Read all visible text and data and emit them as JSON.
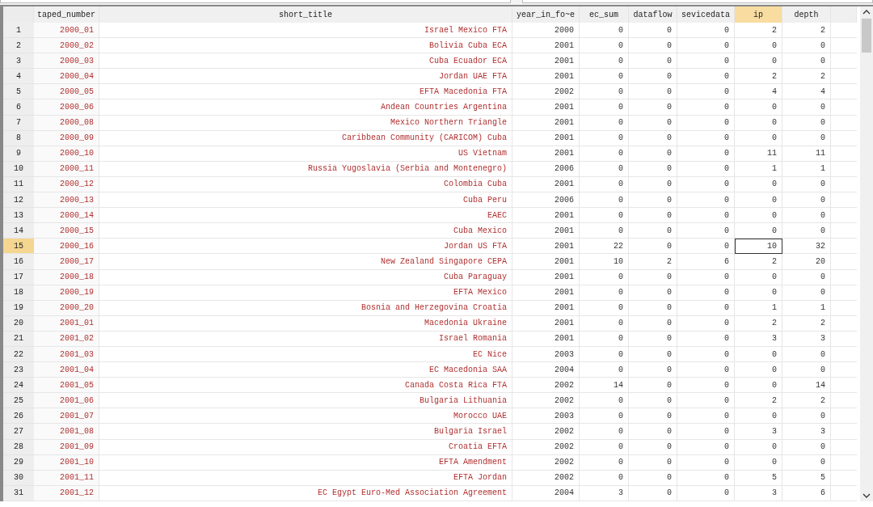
{
  "columns": [
    {
      "label": "taped_number",
      "kind": "string",
      "selected": false
    },
    {
      "label": "short_title",
      "kind": "string",
      "selected": false
    },
    {
      "label": "year_in_fo~e",
      "kind": "number",
      "selected": false
    },
    {
      "label": "ec_sum",
      "kind": "number",
      "selected": false
    },
    {
      "label": "dataflow",
      "kind": "number",
      "selected": false
    },
    {
      "label": "sevicedata",
      "kind": "number",
      "selected": false
    },
    {
      "label": "ip",
      "kind": "number",
      "selected": true
    },
    {
      "label": "depth",
      "kind": "number",
      "selected": false
    }
  ],
  "rows": [
    {
      "number": "1",
      "selected": false,
      "cells": [
        "2000_01",
        "Israel Mexico FTA",
        "2000",
        "0",
        "0",
        "0",
        "2",
        "2"
      ]
    },
    {
      "number": "2",
      "selected": false,
      "cells": [
        "2000_02",
        "Bolivia Cuba ECA",
        "2001",
        "0",
        "0",
        "0",
        "0",
        "0"
      ]
    },
    {
      "number": "3",
      "selected": false,
      "cells": [
        "2000_03",
        "Cuba Ecuador ECA",
        "2001",
        "0",
        "0",
        "0",
        "0",
        "0"
      ]
    },
    {
      "number": "4",
      "selected": false,
      "cells": [
        "2000_04",
        "Jordan UAE FTA",
        "2001",
        "0",
        "0",
        "0",
        "2",
        "2"
      ]
    },
    {
      "number": "5",
      "selected": false,
      "cells": [
        "2000_05",
        "EFTA Macedonia FTA",
        "2002",
        "0",
        "0",
        "0",
        "4",
        "4"
      ]
    },
    {
      "number": "6",
      "selected": false,
      "cells": [
        "2000_06",
        "Andean Countries Argentina",
        "2001",
        "0",
        "0",
        "0",
        "0",
        "0"
      ]
    },
    {
      "number": "7",
      "selected": false,
      "cells": [
        "2000_08",
        "Mexico Northern Triangle",
        "2001",
        "0",
        "0",
        "0",
        "0",
        "0"
      ]
    },
    {
      "number": "8",
      "selected": false,
      "cells": [
        "2000_09",
        "Caribbean Community (CARICOM) Cuba",
        "2001",
        "0",
        "0",
        "0",
        "0",
        "0"
      ]
    },
    {
      "number": "9",
      "selected": false,
      "cells": [
        "2000_10",
        "US Vietnam",
        "2001",
        "0",
        "0",
        "0",
        "11",
        "11"
      ]
    },
    {
      "number": "10",
      "selected": false,
      "cells": [
        "2000_11",
        "Russia Yugoslavia (Serbia and Montenegro)",
        "2006",
        "0",
        "0",
        "0",
        "1",
        "1"
      ]
    },
    {
      "number": "11",
      "selected": false,
      "cells": [
        "2000_12",
        "Colombia Cuba",
        "2001",
        "0",
        "0",
        "0",
        "0",
        "0"
      ]
    },
    {
      "number": "12",
      "selected": false,
      "cells": [
        "2000_13",
        "Cuba Peru",
        "2006",
        "0",
        "0",
        "0",
        "0",
        "0"
      ]
    },
    {
      "number": "13",
      "selected": false,
      "cells": [
        "2000_14",
        "EAEC",
        "2001",
        "0",
        "0",
        "0",
        "0",
        "0"
      ]
    },
    {
      "number": "14",
      "selected": false,
      "cells": [
        "2000_15",
        "Cuba Mexico",
        "2001",
        "0",
        "0",
        "0",
        "0",
        "0"
      ]
    },
    {
      "number": "15",
      "selected": true,
      "cells": [
        "2000_16",
        "Jordan US FTA",
        "2001",
        "22",
        "0",
        "0",
        "10",
        "32"
      ]
    },
    {
      "number": "16",
      "selected": false,
      "cells": [
        "2000_17",
        "New Zealand Singapore CEPA",
        "2001",
        "10",
        "2",
        "6",
        "2",
        "20"
      ]
    },
    {
      "number": "17",
      "selected": false,
      "cells": [
        "2000_18",
        "Cuba Paraguay",
        "2001",
        "0",
        "0",
        "0",
        "0",
        "0"
      ]
    },
    {
      "number": "18",
      "selected": false,
      "cells": [
        "2000_19",
        "EFTA Mexico",
        "2001",
        "0",
        "0",
        "0",
        "0",
        "0"
      ]
    },
    {
      "number": "19",
      "selected": false,
      "cells": [
        "2000_20",
        "Bosnia and Herzegovina Croatia",
        "2001",
        "0",
        "0",
        "0",
        "1",
        "1"
      ]
    },
    {
      "number": "20",
      "selected": false,
      "cells": [
        "2001_01",
        "Macedonia Ukraine",
        "2001",
        "0",
        "0",
        "0",
        "2",
        "2"
      ]
    },
    {
      "number": "21",
      "selected": false,
      "cells": [
        "2001_02",
        "Israel Romania",
        "2001",
        "0",
        "0",
        "0",
        "3",
        "3"
      ]
    },
    {
      "number": "22",
      "selected": false,
      "cells": [
        "2001_03",
        "EC Nice",
        "2003",
        "0",
        "0",
        "0",
        "0",
        "0"
      ]
    },
    {
      "number": "23",
      "selected": false,
      "cells": [
        "2001_04",
        "EC Macedonia SAA",
        "2004",
        "0",
        "0",
        "0",
        "0",
        "0"
      ]
    },
    {
      "number": "24",
      "selected": false,
      "cells": [
        "2001_05",
        "Canada Costa Rica FTA",
        "2002",
        "14",
        "0",
        "0",
        "0",
        "14"
      ]
    },
    {
      "number": "25",
      "selected": false,
      "cells": [
        "2001_06",
        "Bulgaria Lithuania",
        "2002",
        "0",
        "0",
        "0",
        "2",
        "2"
      ]
    },
    {
      "number": "26",
      "selected": false,
      "cells": [
        "2001_07",
        "Morocco UAE",
        "2003",
        "0",
        "0",
        "0",
        "0",
        "0"
      ]
    },
    {
      "number": "27",
      "selected": false,
      "cells": [
        "2001_08",
        "Bulgaria Israel",
        "2002",
        "0",
        "0",
        "0",
        "3",
        "3"
      ]
    },
    {
      "number": "28",
      "selected": false,
      "cells": [
        "2001_09",
        "Croatia EFTA",
        "2002",
        "0",
        "0",
        "0",
        "0",
        "0"
      ]
    },
    {
      "number": "29",
      "selected": false,
      "cells": [
        "2001_10",
        "EFTA Amendment",
        "2002",
        "0",
        "0",
        "0",
        "0",
        "0"
      ]
    },
    {
      "number": "30",
      "selected": false,
      "cells": [
        "2001_11",
        "EFTA Jordan",
        "2002",
        "0",
        "0",
        "0",
        "5",
        "5"
      ]
    },
    {
      "number": "31",
      "selected": false,
      "cells": [
        "2001_12",
        "EC Egypt Euro-Med Association Agreement",
        "2004",
        "3",
        "0",
        "0",
        "3",
        "6"
      ]
    }
  ]
}
